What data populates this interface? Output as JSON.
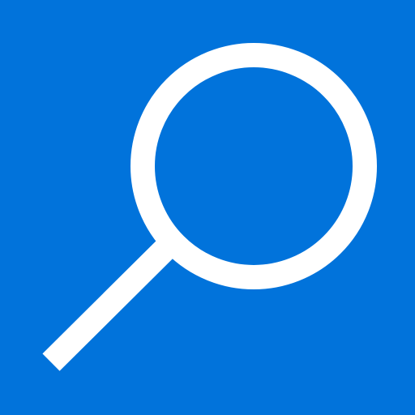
{
  "app_icon": {
    "icon": "search-icon",
    "background_color": "#0173DB",
    "glyph_color": "#FFFFFF"
  }
}
